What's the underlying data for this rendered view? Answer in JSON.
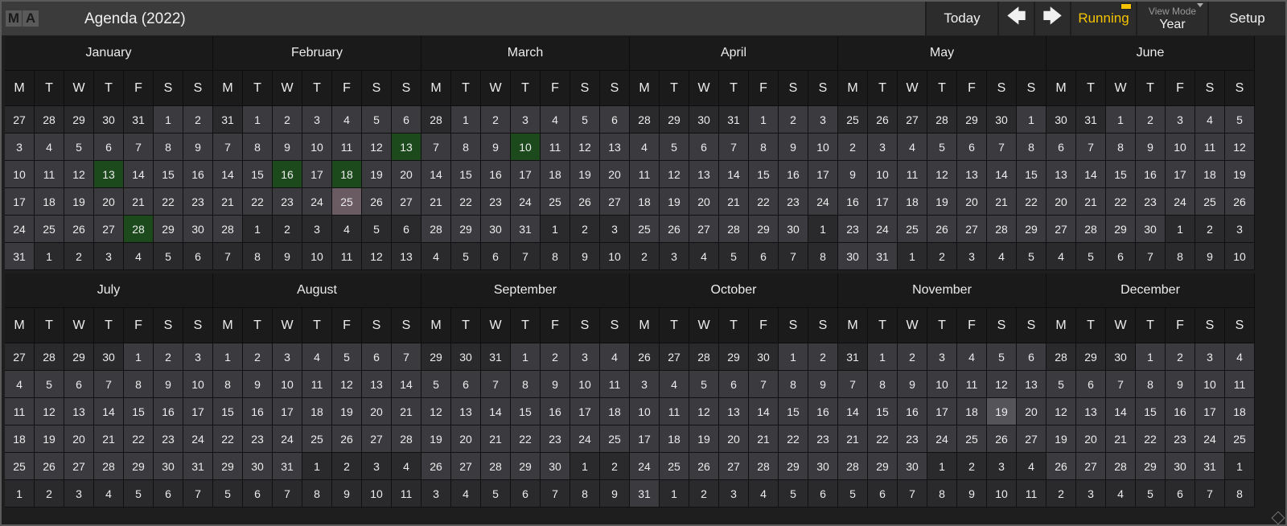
{
  "titlebar": {
    "logo": [
      "M",
      "A"
    ],
    "title": "Agenda (2022)",
    "today_label": "Today",
    "prev_label": "🡄",
    "next_label": "🡆",
    "running_label": "Running",
    "viewmode_label": "View Mode",
    "viewmode_value": "Year",
    "setup_label": "Setup"
  },
  "colors": {
    "running": "#f5c400",
    "event_day": "#1c4a1c",
    "today_day": "#6a5a62"
  },
  "weekday_labels": [
    "M",
    "T",
    "W",
    "T",
    "F",
    "S",
    "S"
  ],
  "months": [
    {
      "name": "January",
      "offset": 5,
      "days": 31,
      "prev_days": 31,
      "events": [
        13,
        28
      ]
    },
    {
      "name": "February",
      "offset": 1,
      "days": 28,
      "prev_days": 31,
      "events": [
        16,
        18,
        13
      ],
      "today": 25
    },
    {
      "name": "March",
      "offset": 1,
      "days": 31,
      "prev_days": 28,
      "events": [
        10
      ]
    },
    {
      "name": "April",
      "offset": 4,
      "days": 30,
      "prev_days": 31,
      "events": []
    },
    {
      "name": "May",
      "offset": 6,
      "days": 31,
      "prev_days": 30,
      "events": []
    },
    {
      "name": "June",
      "offset": 2,
      "days": 30,
      "prev_days": 31,
      "events": []
    },
    {
      "name": "July",
      "offset": 4,
      "days": 31,
      "prev_days": 30,
      "events": []
    },
    {
      "name": "August",
      "offset": 0,
      "days": 31,
      "prev_days": 31,
      "events": []
    },
    {
      "name": "September",
      "offset": 3,
      "days": 30,
      "prev_days": 31,
      "events": []
    },
    {
      "name": "October",
      "offset": 5,
      "days": 31,
      "prev_days": 30,
      "events": []
    },
    {
      "name": "November",
      "offset": 1,
      "days": 30,
      "prev_days": 31,
      "events": [],
      "selected": 19
    },
    {
      "name": "December",
      "offset": 3,
      "days": 31,
      "prev_days": 30,
      "events": []
    }
  ]
}
